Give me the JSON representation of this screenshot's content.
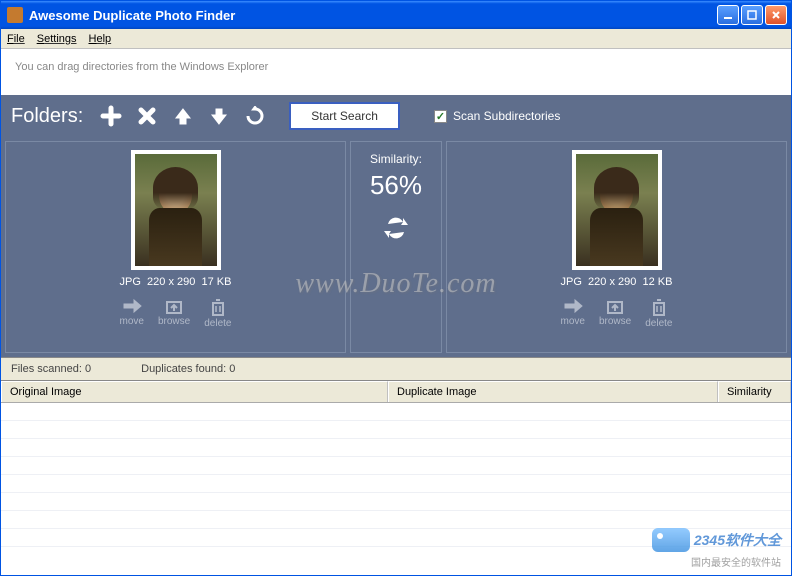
{
  "window": {
    "title": "Awesome Duplicate Photo Finder"
  },
  "menu": {
    "file": "File",
    "settings": "Settings",
    "help": "Help"
  },
  "hint": "You can drag directories from the Windows Explorer",
  "toolbar": {
    "label": "Folders:",
    "start_search": "Start Search",
    "scan_sub": "Scan Subdirectories",
    "scan_sub_checked": "✓"
  },
  "similarity": {
    "label": "Similarity:",
    "value": "56%"
  },
  "left_photo": {
    "format": "JPG",
    "dims": "220 x 290",
    "size": "17 KB"
  },
  "right_photo": {
    "format": "JPG",
    "dims": "220 x 290",
    "size": "12 KB"
  },
  "actions": {
    "move": "move",
    "browse": "browse",
    "delete": "delete"
  },
  "status": {
    "scanned_label": "Files scanned:",
    "scanned": "0",
    "dup_label": "Duplicates found:",
    "dup": "0"
  },
  "columns": {
    "original": "Original Image",
    "duplicate": "Duplicate Image",
    "similarity": "Similarity"
  },
  "watermark": "www.DuoTe.com",
  "branding": {
    "name": "2345软件大全",
    "sub": "国内最安全的软件站"
  }
}
